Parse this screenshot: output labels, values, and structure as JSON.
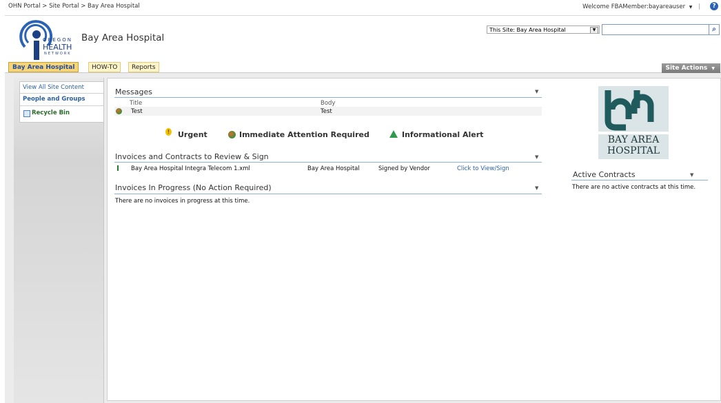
{
  "breadcrumb": {
    "path": "OHN Portal > Site Portal > Bay Area Hospital"
  },
  "user": {
    "welcome": "Welcome FBAMember:bayareauser",
    "menu_caret": "▼"
  },
  "header": {
    "logo_oregon": "OREGON",
    "logo_health": "HEALTH",
    "logo_network": "NETWORK",
    "site_title": "Bay Area Hospital"
  },
  "search": {
    "scope": "This Site: Bay Area Hospital",
    "value": ""
  },
  "nav": {
    "tabs": [
      {
        "label": "Bay Area Hospital",
        "active": true
      },
      {
        "label": "HOW-TO",
        "active": false
      },
      {
        "label": "Reports",
        "active": false
      }
    ],
    "site_actions": "Site Actions"
  },
  "quick_launch": {
    "view_all": "View All Site Content",
    "people": "People and Groups",
    "recycle": "Recycle Bin"
  },
  "messages": {
    "title": "Messages",
    "columns": [
      "Title",
      "Body"
    ],
    "rows": [
      {
        "title": "Test",
        "body": "Test",
        "status": "immediate"
      }
    ]
  },
  "legend": {
    "urgent": "Urgent",
    "immediate": "Immediate Attention Required",
    "informational": "Informational Alert"
  },
  "invoices_review": {
    "title": "Invoices and Contracts to Review & Sign",
    "rows": [
      {
        "file": "Bay Area Hospital Integra Telecom 1.xml",
        "org": "Bay Area Hospital",
        "status": "Signed by Vendor",
        "action": "Click to View/Sign"
      }
    ]
  },
  "invoices_progress": {
    "title": "Invoices In Progress (No Action Required)",
    "empty": "There are no invoices in progress at this time."
  },
  "hospital_logo": {
    "line1": "BAY AREA",
    "line2": "HOSPITAL"
  },
  "active_contracts": {
    "title": "Active Contracts",
    "empty": "There are no active contracts at this time."
  },
  "colors": {
    "accent_blue": "#2b62b6",
    "tab_active": "#f6d478",
    "urgent": "#f2c200",
    "immediate": "#3a8f3a",
    "informational": "#2f9a4c"
  }
}
